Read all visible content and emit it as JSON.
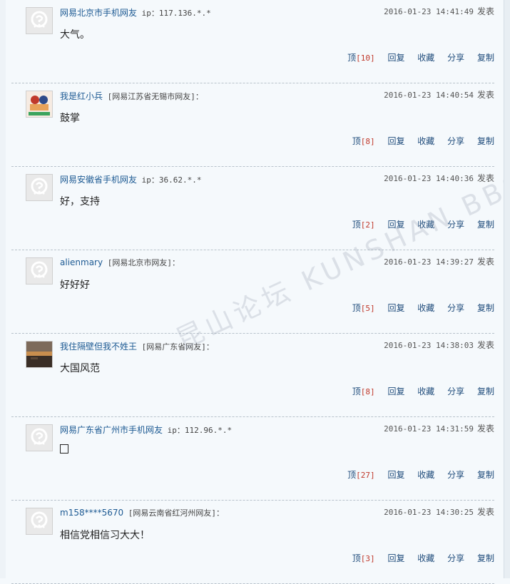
{
  "watermark": "昆山论坛 KUNSHAN BBS",
  "posted_label": "发表",
  "actions": {
    "up": "顶",
    "reply": "回复",
    "collect": "收藏",
    "share": "分享",
    "copy": "复制"
  },
  "comments": [
    {
      "user": "网易北京市手机网友",
      "loc": " ip：117.136.*.*",
      "time": "2016-01-23 14:41:49",
      "content": "大气。",
      "up_count": "[10]",
      "avatar": "default"
    },
    {
      "user": "我是红小兵",
      "loc": " [网易江苏省无锡市网友]：",
      "time": "2016-01-23 14:40:54",
      "content": "鼓掌",
      "up_count": "[8]",
      "avatar": "photo"
    },
    {
      "user": "网易安徽省手机网友",
      "loc": " ip：36.62.*.*",
      "time": "2016-01-23 14:40:36",
      "content": "好，支持",
      "up_count": "[2]",
      "avatar": "default"
    },
    {
      "user": "alienmary",
      "loc": " [网易北京市网友]：",
      "time": "2016-01-23 14:39:27",
      "content": "好好好",
      "up_count": "[5]",
      "avatar": "default"
    },
    {
      "user": "我住隔壁但我不姓王",
      "loc": " [网易广东省网友]：",
      "time": "2016-01-23 14:38:03",
      "content": "大国风范",
      "up_count": "[8]",
      "avatar": "photo"
    },
    {
      "user": "网易广东省广州市手机网友",
      "loc": " ip：112.96.*.*",
      "time": "2016-01-23 14:31:59",
      "content": "",
      "up_count": "[27]",
      "avatar": "default"
    },
    {
      "user": "m158****5670",
      "loc": " [网易云南省红河州网友]：",
      "time": "2016-01-23 14:30:25",
      "content": "相信党相信习大大！",
      "up_count": "[3]",
      "avatar": "default"
    }
  ]
}
